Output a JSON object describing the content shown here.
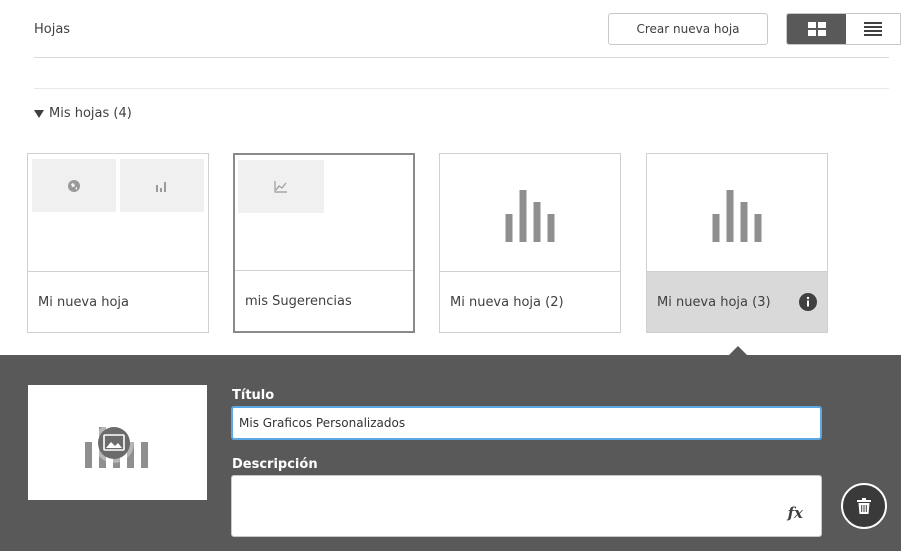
{
  "header": {
    "title": "Hojas",
    "create_button": "Crear nueva hoja",
    "view_modes": {
      "grid_icon": "grid-icon",
      "list_icon": "list-icon",
      "active": "grid"
    }
  },
  "section": {
    "title": "Mis hojas (4)",
    "expanded": true
  },
  "sheets": [
    {
      "label": "Mi nueva hoja",
      "thumbnail_icons": [
        "globe-icon",
        "bar-chart-icon"
      ]
    },
    {
      "label": "mis Sugerencias",
      "thumbnail_icons": [
        "line-chart-icon"
      ]
    },
    {
      "label": "Mi nueva hoja (2)",
      "thumbnail_icons": [
        "sheet-placeholder-icon"
      ]
    },
    {
      "label": "Mi nueva hoja (3)",
      "thumbnail_icons": [
        "sheet-placeholder-icon"
      ],
      "info_icon": "info-icon"
    }
  ],
  "details": {
    "title_label": "Título",
    "title_value": "Mis Graficos Personalizados",
    "description_label": "Descripción",
    "description_value": "",
    "fx_label": "fx",
    "delete_icon": "trash-icon"
  },
  "colors": {
    "panel_bg": "#595959",
    "input_focus": "#5aa9e6",
    "active_card": "#d9d9d9",
    "placeholder_bars": "#8f8f8f"
  }
}
